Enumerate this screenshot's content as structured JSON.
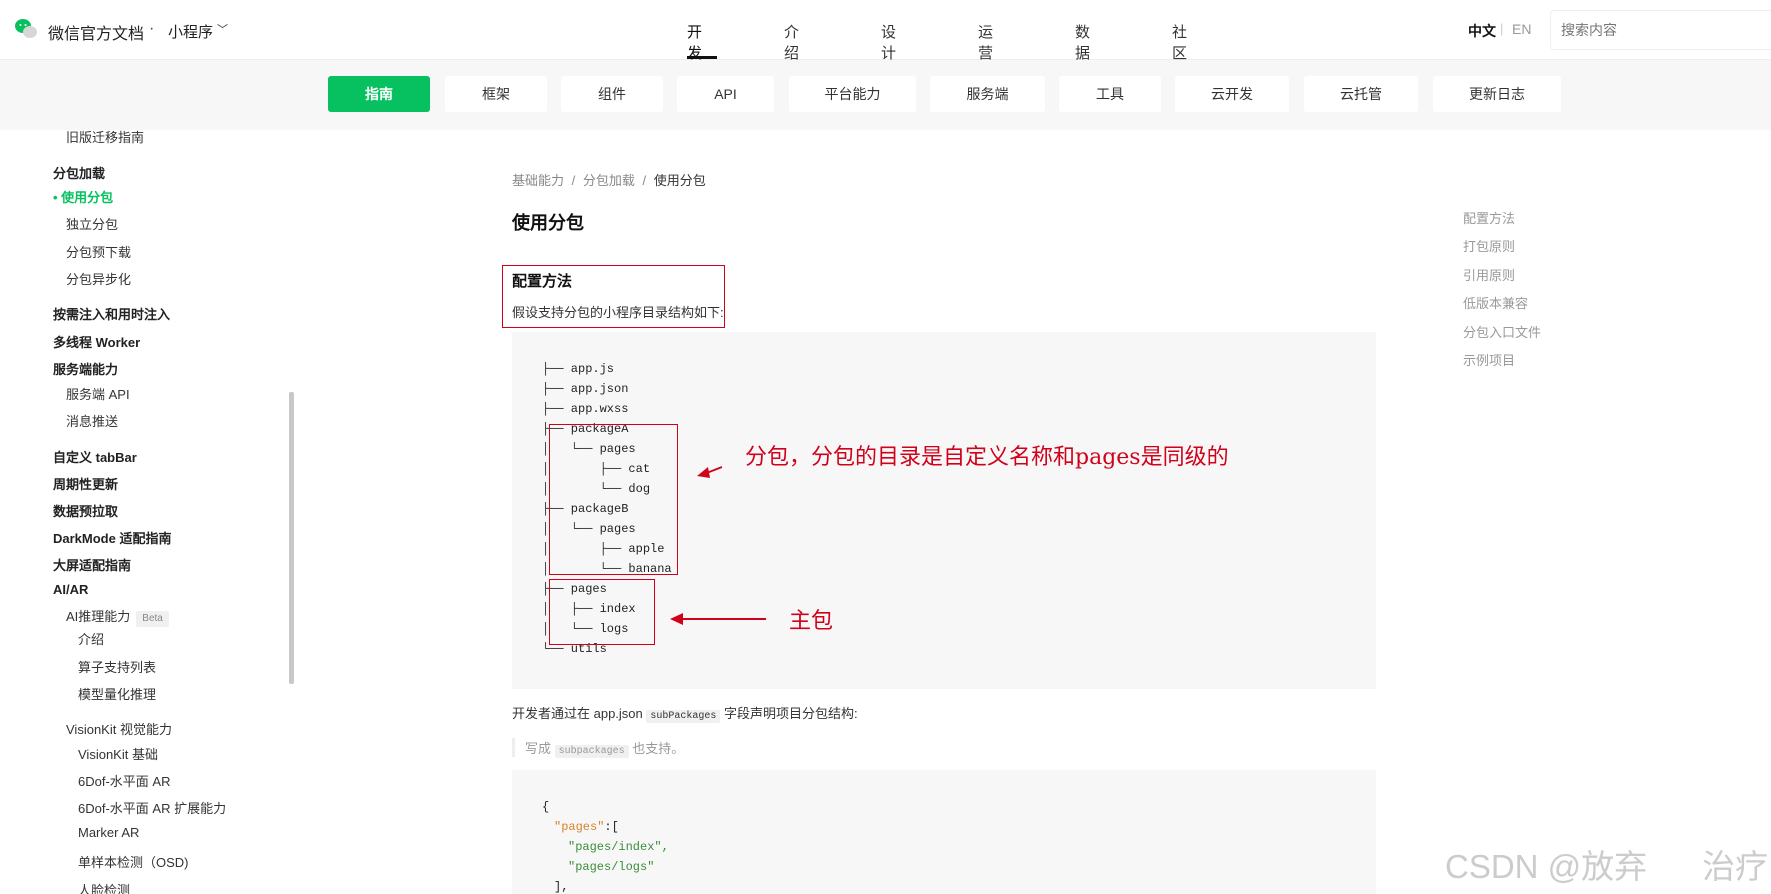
{
  "header": {
    "brand": "微信官方文档",
    "dot": "·",
    "product": "小程序",
    "nav": [
      "开发",
      "介绍",
      "设计",
      "运营",
      "数据",
      "社区"
    ],
    "active_nav": "开发",
    "lang_zh": "中文",
    "lang_sep": "|",
    "lang_en": "EN",
    "search_placeholder": "搜索内容"
  },
  "subnav": {
    "tabs": [
      "指南",
      "框架",
      "组件",
      "API",
      "平台能力",
      "服务端",
      "工具",
      "云开发",
      "云托管",
      "更新日志"
    ],
    "active": "指南"
  },
  "sidebar": {
    "items": [
      {
        "label": "旧版迁移指南"
      },
      {
        "label": "分包加载"
      },
      {
        "label": "• 使用分包"
      },
      {
        "label": "独立分包"
      },
      {
        "label": "分包预下载"
      },
      {
        "label": "分包异步化"
      },
      {
        "label": "按需注入和用时注入"
      },
      {
        "label": "多线程 Worker"
      },
      {
        "label": "服务端能力"
      },
      {
        "label": "服务端 API"
      },
      {
        "label": "消息推送"
      },
      {
        "label": "自定义 tabBar"
      },
      {
        "label": "周期性更新"
      },
      {
        "label": "数据预拉取"
      },
      {
        "label": "DarkMode 适配指南"
      },
      {
        "label": "大屏适配指南"
      },
      {
        "label": "AI/AR"
      },
      {
        "label": "AI推理能力",
        "badge": "Beta"
      },
      {
        "label": "介绍"
      },
      {
        "label": "算子支持列表"
      },
      {
        "label": "模型量化推理"
      },
      {
        "label": "VisionKit 视觉能力"
      },
      {
        "label": "VisionKit 基础"
      },
      {
        "label": "6Dof-水平面 AR"
      },
      {
        "label": "6Dof-水平面 AR 扩展能力"
      },
      {
        "label": "Marker AR"
      },
      {
        "label": "单样本检测（OSD)"
      },
      {
        "label": "人脸检测"
      }
    ]
  },
  "content": {
    "breadcrumb": [
      "基础能力",
      "分包加载",
      "使用分包"
    ],
    "breadcrumb_sep": "/",
    "title": "使用分包",
    "section_heading": "配置方法",
    "intro": "假设支持分包的小程序目录结构如下:",
    "tree": [
      "├── app.js",
      "├── app.json",
      "├── app.wxss",
      "├── packageA",
      "│   └── pages",
      "│       ├── cat",
      "│       └── dog",
      "├── packageB",
      "│   └── pages",
      "│       ├── apple",
      "│       └── banana",
      "├── pages",
      "│   ├── index",
      "│   └── logs",
      "└── utils"
    ],
    "annotation_subpackage": "分包，分包的目录是自定义名称和pages是同级的",
    "annotation_main": "主包",
    "declare_pre": "开发者通过在 app.json",
    "declare_code": "subPackages",
    "declare_post": "字段声明项目分包结构:",
    "note_pre": "写成",
    "note_code": "subpackages",
    "note_post": "也支持。",
    "json": {
      "l1": "{",
      "l2_key": "\"pages\"",
      "l2_rest": ":[",
      "l3": "\"pages/index\",",
      "l4": "\"pages/logs\"",
      "l5": "],"
    }
  },
  "toc": [
    "配置方法",
    "打包原则",
    "引用原则",
    "低版本兼容",
    "分包入口文件",
    "示例项目"
  ],
  "watermark": "CSDN @放弃      治疗",
  "colors": {
    "accent": "#07c160",
    "annotation": "#d0021b"
  }
}
